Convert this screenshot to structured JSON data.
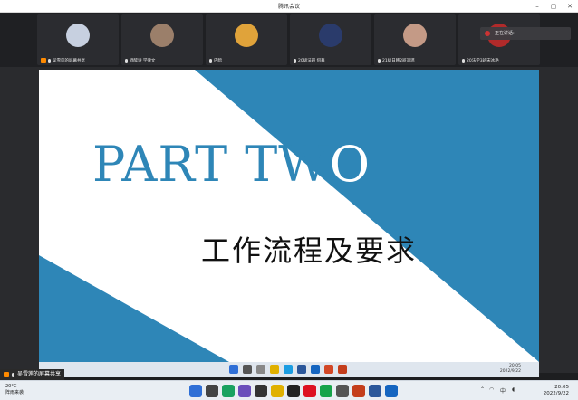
{
  "window": {
    "title": "腾讯会议"
  },
  "participants": [
    {
      "name": "吴雪莲的屏幕共享",
      "sharing": true,
      "avatar_color": "#c7d0e0"
    },
    {
      "name": "酒醉诗 学律文",
      "sharing": false,
      "avatar_color": "#9b7f6a"
    },
    {
      "name": "内暗",
      "sharing": false,
      "avatar_color": "#e0a33a"
    },
    {
      "name": "20级法班 何鑫",
      "sharing": false,
      "avatar_color": "#2a3b6b"
    },
    {
      "name": "21级日韩2班刘瑶",
      "sharing": false,
      "avatar_color": "#c49a86"
    },
    {
      "name": "20法学3班宋冰艳",
      "sharing": false,
      "avatar_color": "#b02a2a"
    }
  ],
  "speaker": {
    "label": "正在讲话:"
  },
  "slide": {
    "part_title_dark": "PART TW",
    "part_title_light": "O",
    "subtitle": "工作流程及要求",
    "colors": {
      "blue": "#2e86b7",
      "white": "#ffffff"
    }
  },
  "inner_taskbar": {
    "time": "20:05",
    "date": "2022/9/22"
  },
  "share_bar": {
    "label": "吴雪莲的屏幕共享"
  },
  "taskbar": {
    "weather_temp": "20°C",
    "weather_desc": "阵雨来袭",
    "ime": "中",
    "time": "20:05",
    "date": "2022/9/22"
  }
}
